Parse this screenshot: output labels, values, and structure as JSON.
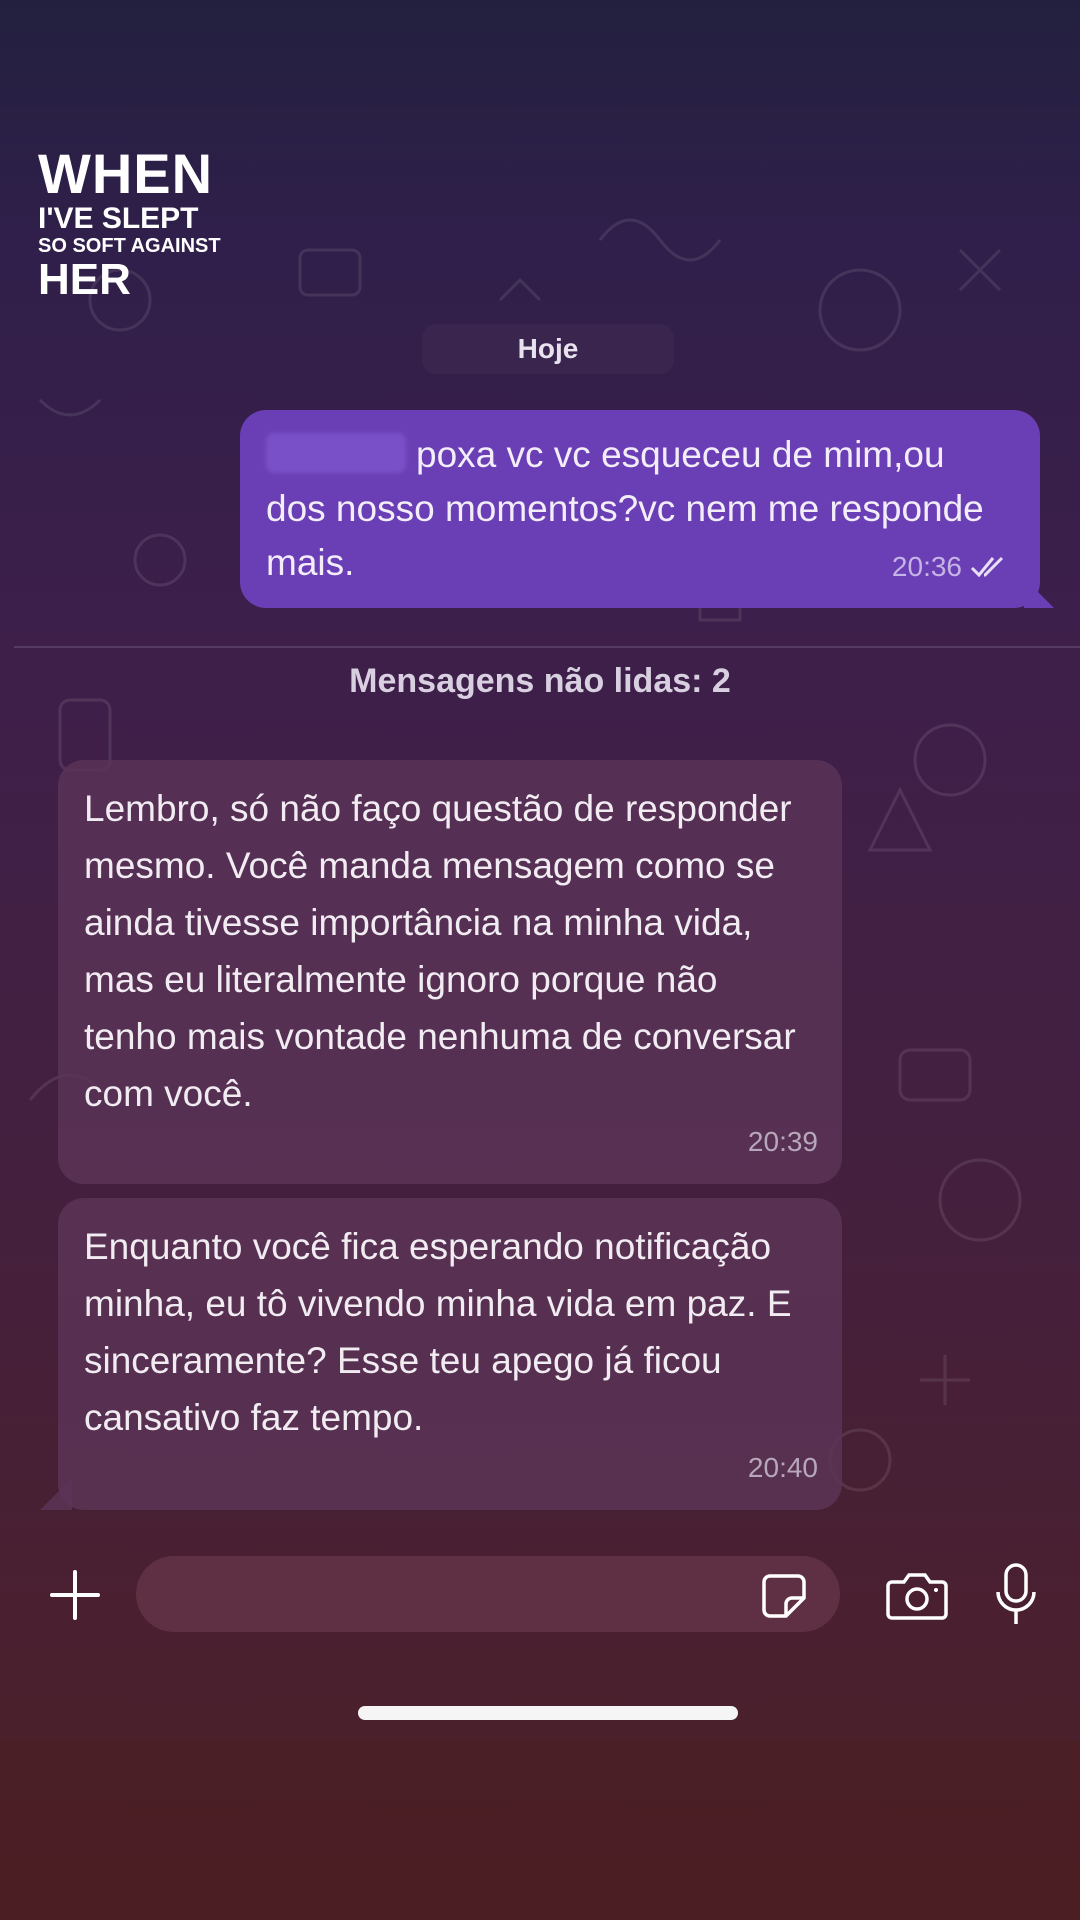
{
  "watermark": {
    "line1": "WHEN",
    "line2": "I'VE SLEPT",
    "line3": "SO SOFT AGAINST",
    "line4": "HER"
  },
  "chat": {
    "date_label": "Hoje",
    "outgoing": {
      "text": "poxa vc vc esqueceu de mim,ou dos nosso momentos?vc nem me responde mais.",
      "time": "20:36",
      "status_icon": "double-check-icon"
    },
    "unread_label": "Mensagens não lidas: 2",
    "incoming": [
      {
        "text": "Lembro, só não faço questão de responder mesmo. Você manda mensagem como se ainda tivesse importância na minha vida, mas eu literalmente ignoro porque não tenho mais vontade nenhuma de conversar com você.",
        "time": "20:39"
      },
      {
        "text": "Enquanto você fica esperando notificação minha, eu tô vivendo minha vida em paz. E sinceramente? Esse teu apego já ficou cansativo faz tempo.",
        "time": "20:40"
      }
    ]
  },
  "composer": {
    "add_icon": "plus-icon",
    "sticker_icon": "sticker-icon",
    "camera_icon": "camera-icon",
    "mic_icon": "microphone-icon"
  },
  "colors": {
    "outgoing_bubble": "#6a3fb5",
    "incoming_bubble": "#5c3458",
    "background_top": "#23203f",
    "background_bottom": "#4a1f25"
  }
}
